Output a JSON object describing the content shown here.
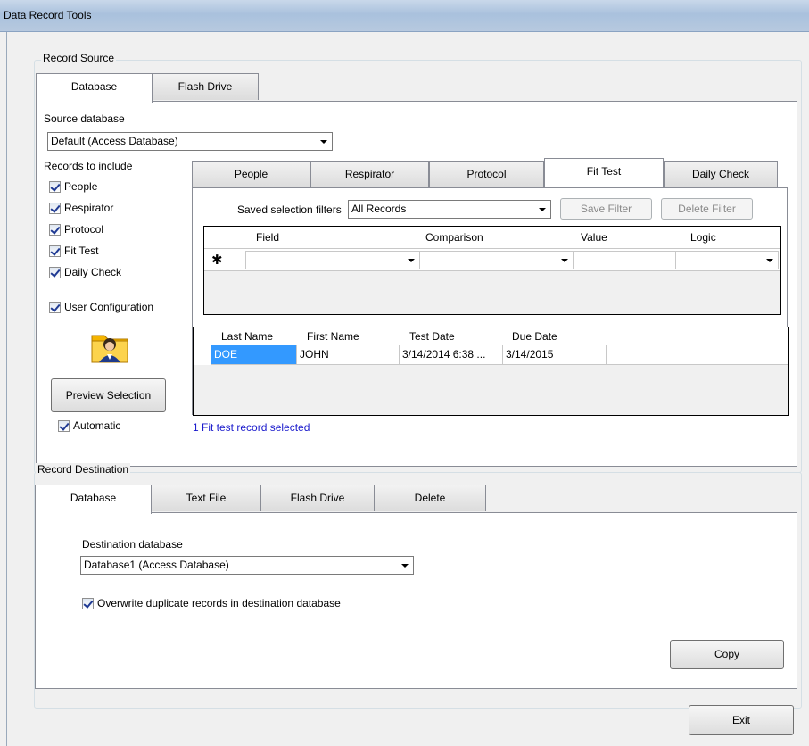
{
  "window": {
    "title": "Data Record Tools"
  },
  "record_source": {
    "legend": "Record Source",
    "tabs": [
      {
        "label": "Database"
      },
      {
        "label": "Flash Drive"
      }
    ],
    "source_label": "Source database",
    "source_value": "Default (Access Database)",
    "records_label": "Records to include",
    "checks": [
      {
        "label": "People",
        "checked": true
      },
      {
        "label": "Respirator",
        "checked": true
      },
      {
        "label": "Protocol",
        "checked": true
      },
      {
        "label": "Fit Test",
        "checked": true
      },
      {
        "label": "Daily Check",
        "checked": true
      },
      {
        "label": "User Configuration",
        "checked": true
      }
    ],
    "preview_label": "Preview Selection",
    "automatic_label": "Automatic",
    "record_tabs": [
      {
        "label": "People"
      },
      {
        "label": "Respirator"
      },
      {
        "label": "Protocol"
      },
      {
        "label": "Fit Test"
      },
      {
        "label": "Daily Check"
      }
    ],
    "filter_label": "Saved selection filters",
    "filter_value": "All Records",
    "save_filter": "Save Filter",
    "delete_filter": "Delete Filter",
    "filter_grid": {
      "columns": [
        "Field",
        "Comparison",
        "Value",
        "Logic"
      ],
      "new_row_marker": "✱"
    },
    "results_grid": {
      "columns": [
        "Last Name",
        "First Name",
        "Test Date",
        "Due Date"
      ],
      "rows": [
        [
          "DOE",
          "JOHN",
          "3/14/2014 6:38 ...",
          "3/14/2015"
        ]
      ]
    },
    "status": "1 Fit test record selected"
  },
  "record_destination": {
    "legend": "Record Destination",
    "tabs": [
      {
        "label": "Database"
      },
      {
        "label": "Text File"
      },
      {
        "label": "Flash Drive"
      },
      {
        "label": "Delete"
      }
    ],
    "dest_label": "Destination database",
    "dest_value": "Database1 (Access Database)",
    "overwrite_label": "Overwrite duplicate records in destination database",
    "copy_label": "Copy"
  },
  "exit_label": "Exit",
  "colors": {
    "selection": "#3399ff",
    "status_text": "#1a1acc"
  },
  "icons": {
    "user_folder": "user-folder-icon"
  }
}
